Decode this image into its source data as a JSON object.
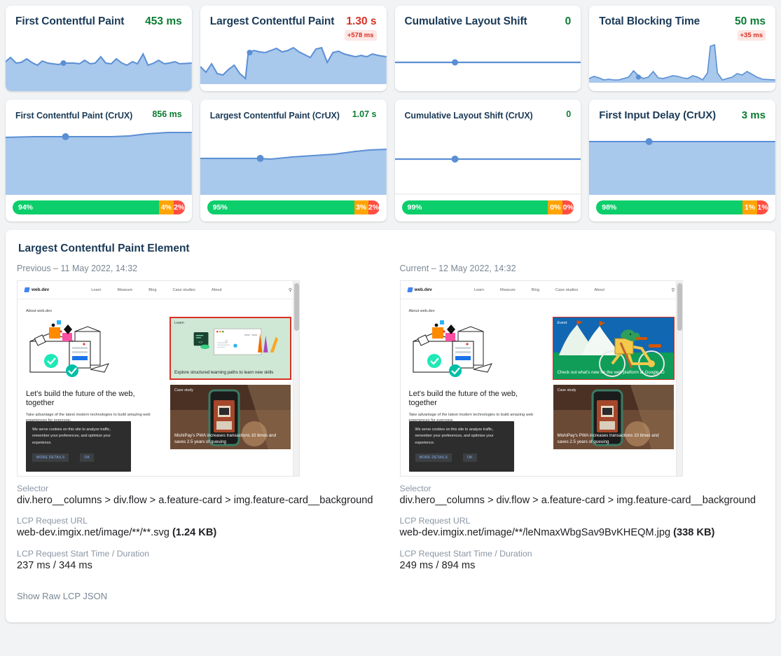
{
  "metrics_row1": [
    {
      "name": "First Contentful Paint",
      "value": "453 ms",
      "value_tone": "good",
      "delta": null,
      "chart": {
        "type": "area",
        "title": "First Contentful Paint",
        "ylabel": "ms",
        "values": [
          52,
          62,
          48,
          50,
          58,
          50,
          44,
          54,
          50,
          48,
          47,
          50,
          49,
          50,
          48,
          54,
          48,
          50,
          62,
          50,
          48,
          58,
          50,
          46,
          52,
          48,
          70,
          46,
          50,
          54,
          48,
          50,
          52,
          48,
          50
        ],
        "marker_index": 8,
        "ylim": [
          0,
          100
        ]
      }
    },
    {
      "name": "Largest Contentful Paint",
      "value": "1.30 s",
      "value_tone": "bad",
      "delta": "+578 ms",
      "chart": {
        "type": "area",
        "title": "Largest Contentful Paint",
        "ylabel": "s",
        "values": [
          40,
          32,
          44,
          30,
          28,
          36,
          42,
          30,
          20,
          72,
          76,
          74,
          72,
          76,
          80,
          74,
          76,
          80,
          74,
          70,
          66,
          78,
          80,
          58,
          72,
          74,
          70,
          68,
          66,
          68,
          66,
          70,
          68,
          66,
          68
        ],
        "marker_index": 9,
        "ylim": [
          0,
          100
        ]
      }
    },
    {
      "name": "Cumulative Layout Shift",
      "value": "0",
      "value_tone": "good",
      "delta": null,
      "chart": {
        "type": "line",
        "title": "Cumulative Layout Shift",
        "values": [
          0,
          0,
          0,
          0,
          0,
          0,
          0,
          0,
          0,
          0,
          0,
          0,
          0,
          0,
          0,
          0,
          0,
          0,
          0,
          0,
          0,
          0,
          0,
          0,
          0,
          0,
          0,
          0,
          0,
          0,
          0,
          0,
          0,
          0,
          0
        ],
        "marker_index": 11,
        "ylim": [
          0,
          1
        ]
      }
    },
    {
      "name": "Total Blocking Time",
      "value": "50 ms",
      "value_tone": "good",
      "delta": "+35 ms",
      "chart": {
        "type": "area",
        "title": "Total Blocking Time",
        "ylabel": "ms",
        "values": [
          8,
          14,
          10,
          6,
          7,
          6,
          6,
          8,
          10,
          24,
          12,
          8,
          10,
          22,
          9,
          8,
          10,
          12,
          11,
          9,
          8,
          12,
          10,
          6,
          18,
          96,
          20,
          6,
          8,
          10,
          16,
          14,
          22,
          16,
          12,
          8,
          6
        ],
        "marker_index": 11,
        "ylim": [
          0,
          100
        ]
      }
    }
  ],
  "metrics_row2": [
    {
      "name": "First Contentful Paint (CrUX)",
      "value": "856 ms",
      "value_tone": "good",
      "emphasis": false,
      "chart": {
        "type": "area",
        "title": "First Contentful Paint (CrUX)",
        "values": [
          86,
          86,
          86,
          86,
          86,
          86,
          86,
          86,
          86,
          86,
          86,
          86,
          86,
          86,
          86,
          86,
          86,
          86,
          86,
          86,
          86,
          86,
          87,
          88,
          88,
          89,
          89,
          90,
          90,
          90,
          90,
          90,
          90,
          90,
          90
        ],
        "marker_index": 8,
        "ylim": [
          0,
          100
        ]
      },
      "distribution": {
        "good": "94%",
        "needs_improvement": "4%",
        "poor": "2%",
        "good_pct": 94,
        "ni_pct": 4,
        "poor_pct": 2
      }
    },
    {
      "name": "Largest Contentful Paint (CrUX)",
      "value": "1.07 s",
      "value_tone": "good",
      "emphasis": false,
      "chart": {
        "type": "area",
        "title": "Largest Contentful Paint (CrUX)",
        "values": [
          54,
          54,
          54,
          54,
          54,
          54,
          54,
          54,
          54,
          54,
          55,
          55,
          56,
          56,
          57,
          57,
          58,
          58,
          59,
          59,
          60,
          60,
          61,
          61,
          62,
          63,
          64,
          64,
          65,
          66,
          67,
          67,
          68,
          69,
          70
        ],
        "marker_index": 8,
        "ylim": [
          0,
          100
        ]
      },
      "distribution": {
        "good": "95%",
        "needs_improvement": "3%",
        "poor": "2%",
        "good_pct": 95,
        "ni_pct": 3,
        "poor_pct": 2
      }
    },
    {
      "name": "Cumulative Layout Shift (CrUX)",
      "value": "0",
      "value_tone": "good",
      "emphasis": false,
      "chart": {
        "type": "line",
        "title": "Cumulative Layout Shift (CrUX)",
        "values": [
          0,
          0,
          0,
          0,
          0,
          0,
          0,
          0,
          0,
          0,
          0,
          0,
          0,
          0,
          0,
          0,
          0,
          0,
          0,
          0,
          0,
          0,
          0,
          0,
          0,
          0,
          0,
          0,
          0,
          0,
          0,
          0,
          0,
          0,
          0
        ],
        "marker_index": 11,
        "ylim": [
          0,
          1
        ]
      },
      "distribution": {
        "good": "99%",
        "needs_improvement": "0%",
        "poor": "0%",
        "good_pct": 99,
        "ni_pct": 5,
        "poor_pct": 5
      }
    },
    {
      "name": "First Input Delay (CrUX)",
      "value": "3 ms",
      "value_tone": "good",
      "emphasis": true,
      "chart": {
        "type": "area",
        "title": "First Input Delay (CrUX)",
        "values": [
          97,
          97,
          97,
          97,
          97,
          97,
          97,
          97,
          97,
          97,
          97,
          97,
          97,
          97,
          97,
          97,
          97,
          97,
          97,
          97,
          97,
          97,
          97,
          97,
          97,
          97,
          97,
          97,
          97,
          97,
          97,
          97,
          97,
          97,
          97
        ],
        "marker_index": 8,
        "ylim": [
          0,
          100
        ]
      },
      "distribution": {
        "good": "98%",
        "needs_improvement": "1%",
        "poor": "1%",
        "good_pct": 98,
        "ni_pct": 5,
        "poor_pct": 5
      }
    }
  ],
  "lcp_panel": {
    "title": "Largest Contentful Paint Element",
    "raw_link": "Show Raw LCP JSON",
    "labels": {
      "selector": "Selector",
      "request_url": "LCP Request URL",
      "start_duration": "LCP Request Start Time / Duration"
    },
    "previous": {
      "heading": "Previous – 11 May 2022, 14:32",
      "selector": "div.hero__columns > div.flow > a.feature-card > img.feature-card__background",
      "request_url": "web-dev.imgix.net/image/**/**.svg ",
      "request_size": "(1.24 KB)",
      "start_duration": "237 ms / 344 ms"
    },
    "current": {
      "heading": "Current – 12 May 2022, 14:32",
      "selector": "div.hero__columns > div.flow > a.feature-card > img.feature-card__background",
      "request_url": "web-dev.imgix.net/image/**/leNmaxWbgSav9BvKHEQM.jpg ",
      "request_size": "(338 KB)",
      "start_duration": "249 ms / 894 ms"
    }
  },
  "site_mock": {
    "brand": "web.dev",
    "nav": [
      "Learn",
      "Measure",
      "Blog",
      "Case studies",
      "About"
    ],
    "search_icon": "search-icon",
    "kicker": "About web.dev",
    "headline": "Let's build the future of the web, together",
    "subhead": "Take advantage of the latest modern technologies to build amazing web experiences for everyone.",
    "feature_previous": {
      "label": "Learn",
      "caption": "Explore structured learning paths to learn new skills"
    },
    "feature_current": {
      "label": "Event",
      "caption": "Check out what's new for the web platform at Google IO"
    },
    "case_study": {
      "label": "Case study",
      "caption": "MishiPay's PWA increases transactions 10 times and saves 2.5 years of queuing"
    },
    "cookie": {
      "text": "We serve cookies on this site to analyze traffic, remember your preferences, and optimize your experience.",
      "more": "MORE DETAILS",
      "ok": "OK"
    }
  },
  "colors": {
    "good": "#0b7c33",
    "bad": "#d93025",
    "chart_line": "#5b8fd4",
    "chart_fill": "#a8c8ec",
    "dist_good": "#0cce6b",
    "dist_ni": "#ffa400",
    "dist_poor": "#ff4e42",
    "title": "#1b3a57"
  }
}
